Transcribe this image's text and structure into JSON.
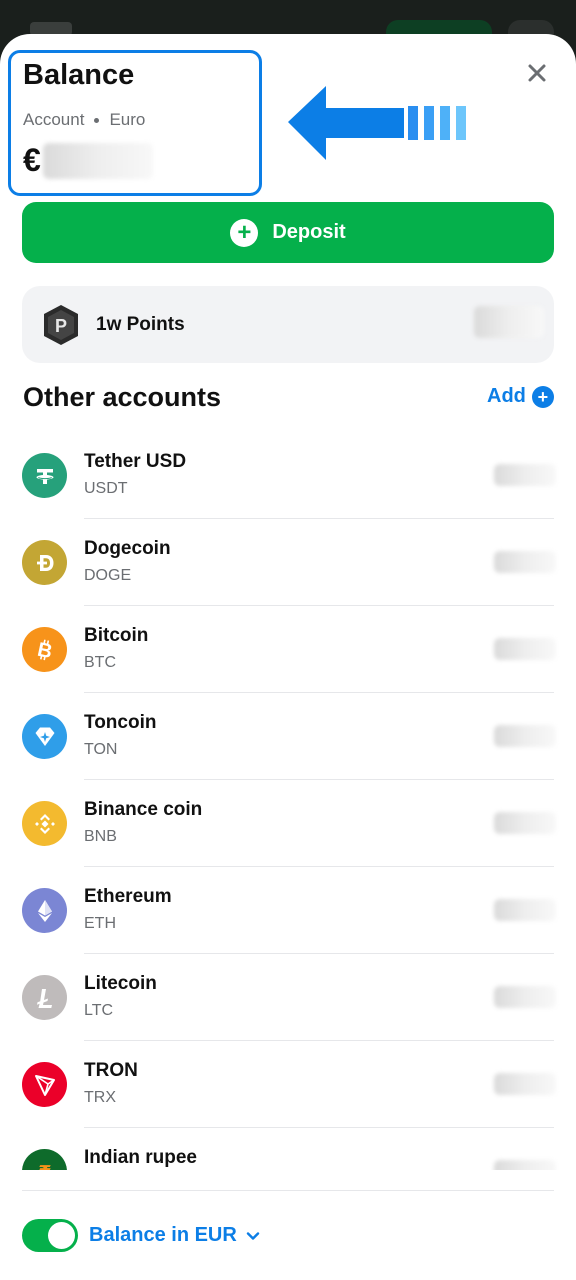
{
  "header": {
    "title": "Balance",
    "account_label": "Account",
    "currency_name": "Euro",
    "currency_symbol": "€"
  },
  "actions": {
    "deposit_label": "Deposit"
  },
  "points": {
    "label": "1w Points"
  },
  "other_accounts": {
    "title": "Other accounts",
    "add_label": "Add",
    "items": [
      {
        "name": "Tether USD",
        "ticker": "USDT",
        "color": "#26a17b",
        "icon": "tether-icon"
      },
      {
        "name": "Dogecoin",
        "ticker": "DOGE",
        "color": "#c3a634",
        "icon": "dogecoin-icon"
      },
      {
        "name": "Bitcoin",
        "ticker": "BTC",
        "color": "#f7931a",
        "icon": "bitcoin-icon"
      },
      {
        "name": "Toncoin",
        "ticker": "TON",
        "color": "#2f9ee9",
        "icon": "toncoin-icon"
      },
      {
        "name": "Binance coin",
        "ticker": "BNB",
        "color": "#f3ba2f",
        "icon": "binance-icon"
      },
      {
        "name": "Ethereum",
        "ticker": "ETH",
        "color": "#7b86d4",
        "icon": "ethereum-icon"
      },
      {
        "name": "Litecoin",
        "ticker": "LTC",
        "color": "#bfbbbb",
        "icon": "litecoin-icon"
      },
      {
        "name": "TRON",
        "ticker": "TRX",
        "color": "#eb0029",
        "icon": "tron-icon"
      },
      {
        "name": "Indian rupee",
        "ticker": "",
        "color": "#0e6b2b",
        "icon": "rupee-icon"
      }
    ]
  },
  "footer": {
    "toggle_on": true,
    "label": "Balance in EUR"
  },
  "colors": {
    "accent_green": "#05b04b",
    "accent_blue": "#0c7ee6"
  }
}
